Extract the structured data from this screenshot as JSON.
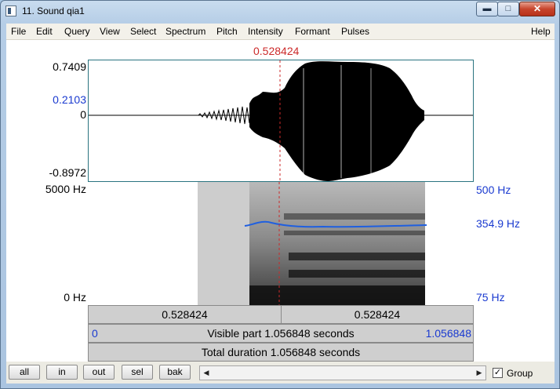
{
  "window": {
    "title": "11. Sound qia1",
    "controls": {
      "minimize": "▬",
      "maximize": "□",
      "close": "✕"
    }
  },
  "menu": [
    "File",
    "Edit",
    "Query",
    "View",
    "Select",
    "Spectrum",
    "Pitch",
    "Intensity",
    "Formant",
    "Pulses"
  ],
  "menu_help": "Help",
  "cursor": {
    "time_label": "0.528424",
    "position_fraction": 0.5
  },
  "waveform": {
    "max_label": "0.7409",
    "cursor_value_label": "0.2103",
    "zero_label": "0",
    "min_label": "-0.8972"
  },
  "spectrogram": {
    "top_label": "5000 Hz",
    "bottom_label": "0 Hz",
    "pitch_top_label": "500 Hz",
    "pitch_value_label": "354.9 Hz",
    "pitch_bottom_label": "75 Hz",
    "pitch_color": "#1f5fe0"
  },
  "bars": {
    "left_segment": "0.528424",
    "right_segment": "0.528424",
    "visible_start": "0",
    "visible_text": "Visible part 1.056848 seconds",
    "visible_end": "1.056848",
    "total_text": "Total duration 1.056848 seconds"
  },
  "buttons": {
    "all": "all",
    "in": "in",
    "out": "out",
    "sel": "sel",
    "bak": "bak"
  },
  "scroll": {
    "left": "◀",
    "right": "▶"
  },
  "group": {
    "label": "Group",
    "checked": "✓"
  },
  "colors": {
    "cursor": "#cc2a2a",
    "axis_blue": "#1a3ad0"
  }
}
